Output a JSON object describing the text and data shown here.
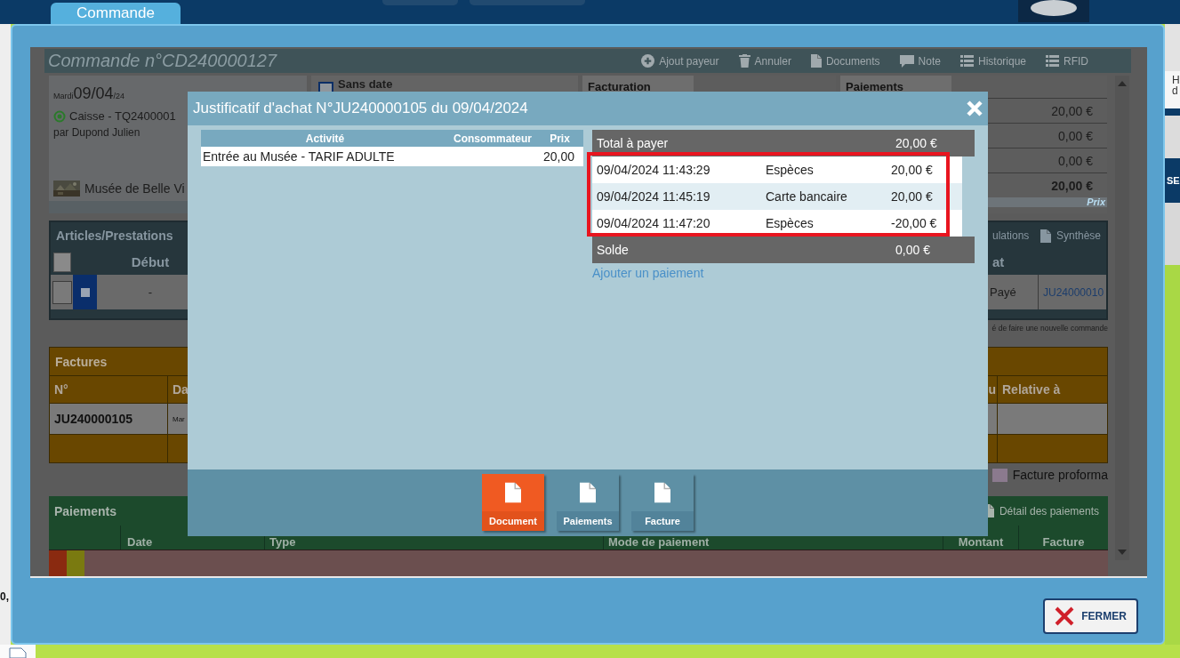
{
  "top_tab": {
    "label": "Commande",
    "selected": true
  },
  "order": {
    "title": "Commande n°CD240000127",
    "toolbar": [
      {
        "label": "Ajout payeur"
      },
      {
        "label": "Annuler"
      },
      {
        "label": "Documents"
      },
      {
        "label": "Note"
      },
      {
        "label": "Historique"
      },
      {
        "label": "RFID"
      }
    ],
    "info": {
      "weekday": "Mardi",
      "date": "09/04",
      "year": "/24",
      "channel": "Caisse - TQ2400001",
      "by": "par Dupond Julien",
      "venue": "Musée de Belle Vi"
    },
    "date_option": {
      "label": "Sans date",
      "checked": false
    },
    "billing": {
      "title": "Facturation"
    },
    "payments_summary": {
      "title": "Paiements",
      "amounts": [
        "20,00 €",
        "0,00 €",
        "0,00 €"
      ],
      "total": "20,00 €",
      "footer": "Prix"
    },
    "articles": {
      "title": "Articles/Prestations",
      "actions": [
        {
          "label": "ulations"
        },
        {
          "label": "Synthèse"
        }
      ],
      "select_all": {
        "checked": false
      },
      "columns": [
        "Début",
        "at"
      ],
      "rows": [
        {
          "checked": false,
          "start": "-",
          "status": "Payé",
          "invoice": "JU24000010"
        }
      ],
      "note": "é de faire une nouvelle commande"
    },
    "invoices": {
      "title": "Factures",
      "columns": [
        "N°",
        "Da",
        "u",
        "Relative à"
      ],
      "rows": [
        {
          "number": "JU240000105",
          "date": "Mar"
        }
      ],
      "legend": "Facture proforma"
    },
    "payments": {
      "title": "Paiements",
      "detail": "Détail des paiements",
      "columns": [
        "Date",
        "Type",
        "Mode de paiement",
        "Montant",
        "Facture"
      ]
    }
  },
  "right_edge": {
    "lines": [
      "H",
      "d"
    ],
    "banner": "SE"
  },
  "left_edge": {
    "value": "0,"
  },
  "receipt": {
    "title": "Justificatif d'achat N°JU240000105 du 09/04/2024",
    "columns": [
      "Activité",
      "Consommateur",
      "Prix"
    ],
    "rows": [
      {
        "activity": "Entrée au Musée - TARIF ADULTE",
        "price": "20,00"
      }
    ],
    "total": {
      "label": "Total à payer",
      "amount": "20,00 €"
    },
    "payments": [
      {
        "date": "09/04/2024 11:43:29",
        "mode": "Espèces",
        "amount": "20,00 €"
      },
      {
        "date": "09/04/2024 11:45:19",
        "mode": "Carte bancaire",
        "amount": "20,00 €"
      },
      {
        "date": "09/04/2024 11:47:20",
        "mode": "Espèces",
        "amount": "-20,00 €"
      }
    ],
    "payments_highlighted": true,
    "balance": {
      "label": "Solde",
      "amount": "0,00 €"
    },
    "add_link": "Ajouter un paiement",
    "tabs": [
      {
        "label": "Document",
        "selected": true
      },
      {
        "label": "Paiements",
        "selected": false
      },
      {
        "label": "Facture",
        "selected": false
      }
    ]
  },
  "close_button": "FERMER"
}
